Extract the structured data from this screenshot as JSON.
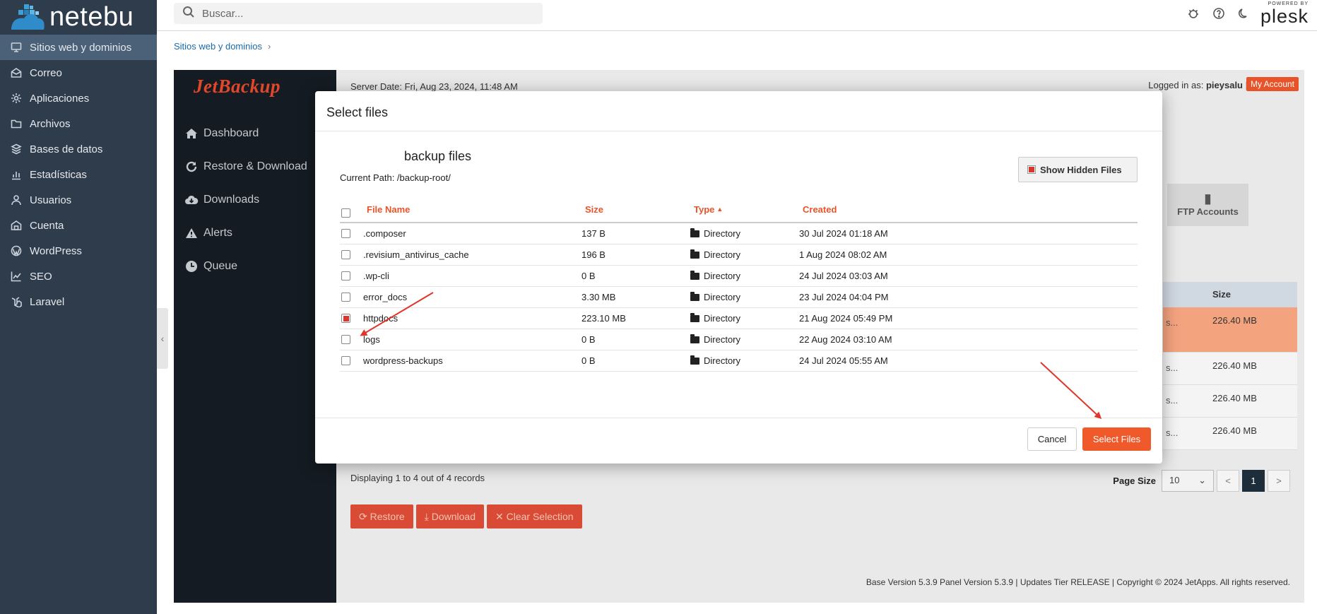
{
  "brand": {
    "name": "netebu"
  },
  "search": {
    "placeholder": "Buscar..."
  },
  "topbar": {
    "powered_by": "POWERED BY",
    "product": "plesk"
  },
  "sidebar": {
    "items": [
      {
        "label": "Sitios web y dominios",
        "icon": "monitor-icon",
        "active": true
      },
      {
        "label": "Correo",
        "icon": "mail-icon"
      },
      {
        "label": "Aplicaciones",
        "icon": "gear-icon"
      },
      {
        "label": "Archivos",
        "icon": "folder-icon"
      },
      {
        "label": "Bases de datos",
        "icon": "database-icon"
      },
      {
        "label": "Estadísticas",
        "icon": "bar-chart-icon"
      },
      {
        "label": "Usuarios",
        "icon": "user-icon"
      },
      {
        "label": "Cuenta",
        "icon": "briefcase-icon"
      },
      {
        "label": "WordPress",
        "icon": "wordpress-icon"
      },
      {
        "label": "SEO",
        "icon": "seo-chart-icon"
      },
      {
        "label": "Laravel",
        "icon": "laravel-icon"
      }
    ]
  },
  "breadcrumb": {
    "item": "Sitios web y dominios"
  },
  "jetbackup": {
    "logo": "JetBackup",
    "server_date": "Server Date: Fri, Aug 23, 2024, 11:48 AM",
    "logged_prefix": "Logged in as:",
    "user": "pieysalu",
    "my_account": "My Account",
    "nav": [
      {
        "label": "Dashboard",
        "icon": "home-icon"
      },
      {
        "label": "Restore & Download",
        "icon": "refresh-icon"
      },
      {
        "label": "Downloads",
        "icon": "cloud-download-icon"
      },
      {
        "label": "Alerts",
        "icon": "warning-icon"
      },
      {
        "label": "Queue",
        "icon": "clock-icon"
      }
    ],
    "ftp_card": "FTP Accounts",
    "bg_table": {
      "size_header": "Size",
      "sizes": [
        "226.40 MB",
        "226.40 MB",
        "226.40 MB",
        "226.40 MB"
      ]
    },
    "records": "Displaying 1 to 4 out of 4 records",
    "page_size_label": "Page Size",
    "page_size_value": "10",
    "current_page": "1",
    "prev": "<",
    "next": ">",
    "actions": {
      "restore": "Restore",
      "download": "Download",
      "clear": "Clear Selection"
    },
    "footer": "Base Version 5.3.9 Panel Version 5.3.9 | Updates Tier RELEASE | Copyright © 2024 JetApps. All rights reserved."
  },
  "modal": {
    "title": "Select files",
    "browser_title": "backup files",
    "current_path": "Current Path: /backup-root/",
    "show_hidden": "Show Hidden Files",
    "columns": {
      "name": "File Name",
      "size": "Size",
      "type": "Type",
      "created": "Created"
    },
    "rows": [
      {
        "name": ".composer",
        "size": "137 B",
        "type": "Directory",
        "created": "30 Jul 2024 01:18 AM",
        "checked": false
      },
      {
        "name": ".revisium_antivirus_cache",
        "size": "196 B",
        "type": "Directory",
        "created": "1 Aug 2024 08:02 AM",
        "checked": false
      },
      {
        "name": ".wp-cli",
        "size": "0 B",
        "type": "Directory",
        "created": "24 Jul 2024 03:03 AM",
        "checked": false
      },
      {
        "name": "error_docs",
        "size": "3.30 MB",
        "type": "Directory",
        "created": "23 Jul 2024 04:04 PM",
        "checked": false
      },
      {
        "name": "httpdocs",
        "size": "223.10 MB",
        "type": "Directory",
        "created": "21 Aug 2024 05:49 PM",
        "checked": true
      },
      {
        "name": "logs",
        "size": "0 B",
        "type": "Directory",
        "created": "22 Aug 2024 03:10 AM",
        "checked": false
      },
      {
        "name": "wordpress-backups",
        "size": "0 B",
        "type": "Directory",
        "created": "24 Jul 2024 05:55 AM",
        "checked": false
      }
    ],
    "cancel": "Cancel",
    "select": "Select Files"
  },
  "colors": {
    "accent": "#f05a2a",
    "sidebar": "#2e3c4c",
    "annotation_arrow": "#e0352b"
  }
}
